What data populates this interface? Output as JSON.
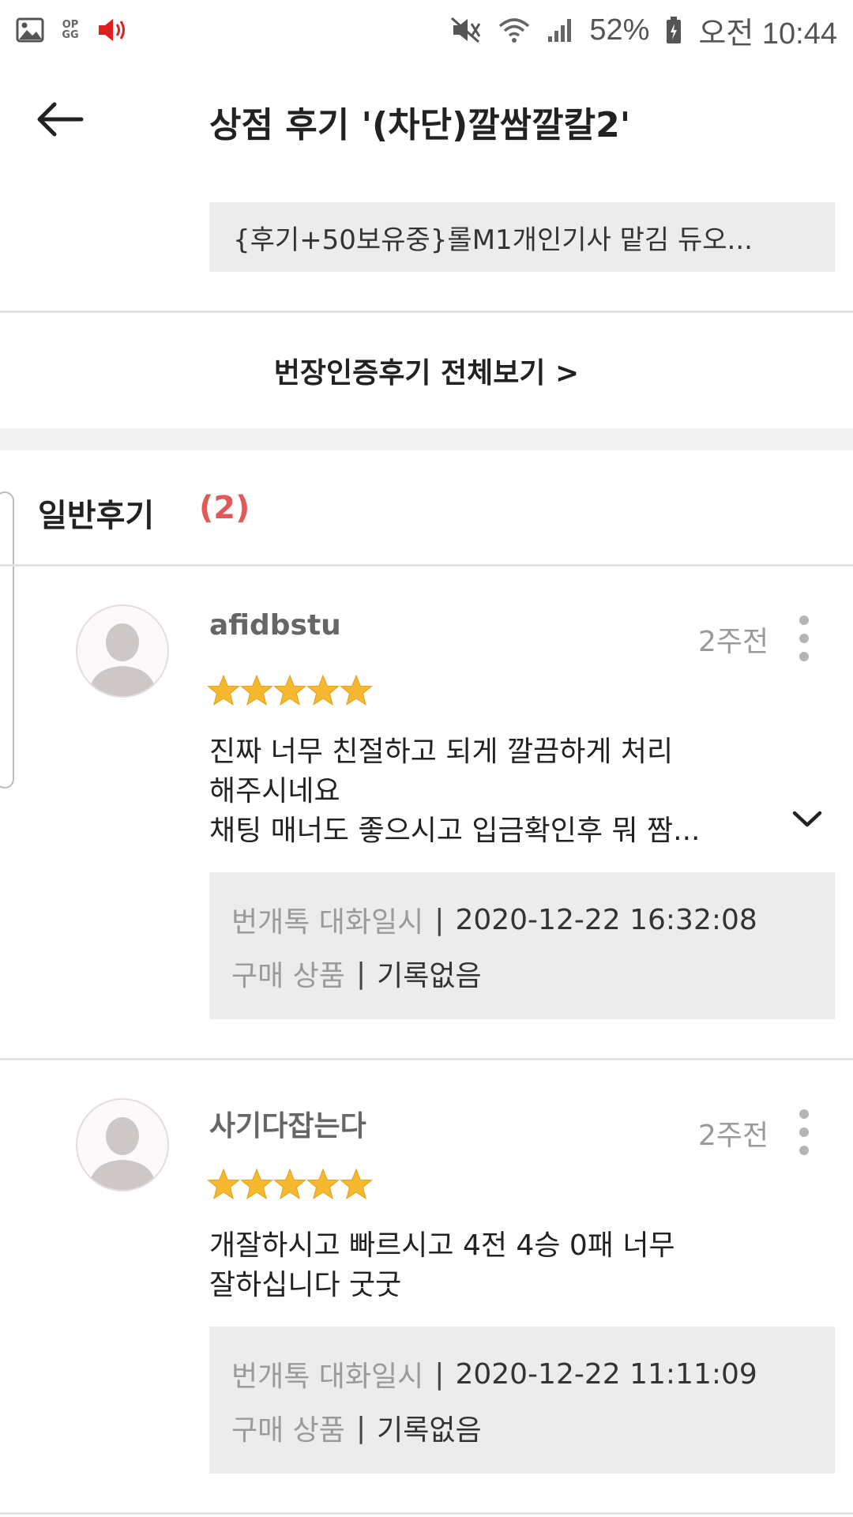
{
  "status_bar": {
    "battery": "52%",
    "time": "오전 10:44",
    "opgg_top": "OP",
    "opgg_bottom": "GG",
    "icons": [
      "image-icon",
      "opgg-icon",
      "volume-icon",
      "mute-icon",
      "wifi-icon",
      "signal-icon",
      "battery-icon"
    ],
    "alert_color": "#e02020"
  },
  "header": {
    "title": "상점 후기 '(차단)깔쌈깔칼2'",
    "back_icon": "arrow-left-icon"
  },
  "product_chip": "{후기+50보유중}롤M1개인기사 맡김 듀오...",
  "verified_reviews_link": "번장인증후기 전체보기 >",
  "general_reviews": {
    "label": "일반후기",
    "count": "(2)",
    "count_color": "#e05a5a"
  },
  "reviews": [
    {
      "username": "afidbstu",
      "time_ago": "2주전",
      "rating": 5,
      "lines": [
        "진짜 너무 친절하고 되게 깔끔하게 처리",
        "해주시네요",
        "채팅 매너도 좋으시고 입금확인후 뭐 짬..."
      ],
      "expandable": true,
      "chat_date_label": "번개톡 대화일시",
      "chat_date": "2020-12-22 16:32:08",
      "product_label": "구매 상품",
      "product_value": "기록없음"
    },
    {
      "username": "사기다잡는다",
      "time_ago": "2주전",
      "rating": 5,
      "lines": [
        "개잘하시고 빠르시고 4전 4승 0패 너무",
        "잘하십니다 굿굿"
      ],
      "expandable": false,
      "chat_date_label": "번개톡 대화일시",
      "chat_date": "2020-12-22 11:11:09",
      "product_label": "구매 상품",
      "product_value": "기록없음"
    }
  ],
  "star_color": "#f5b82e"
}
